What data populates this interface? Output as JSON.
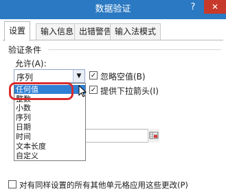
{
  "window": {
    "title": "数据验证",
    "help": "?",
    "close": "✕"
  },
  "tabs": [
    {
      "label": "设置",
      "active": true
    },
    {
      "label": "输入信息",
      "active": false
    },
    {
      "label": "出错警告",
      "active": false
    },
    {
      "label": "输入法模式",
      "active": false
    }
  ],
  "criteria": {
    "group_label": "验证条件",
    "allow_label": "允许(A):",
    "allow_value": "序列",
    "dropdown_arrow": "▼",
    "ignore_blank": {
      "label": "忽略空值(B)",
      "checked": true,
      "mark": "✓"
    },
    "in_cell_dropdown": {
      "label": "提供下拉箭头(I)",
      "checked": true,
      "mark": "✓"
    },
    "options": [
      "任何值",
      "整数",
      "小数",
      "序列",
      "日期",
      "时间",
      "文本长度",
      "自定义"
    ],
    "selected_option": "任何值"
  },
  "apply_all": {
    "label": "对有同样设置的所有其他单元格应用这些更改(P)",
    "checked": false
  }
}
